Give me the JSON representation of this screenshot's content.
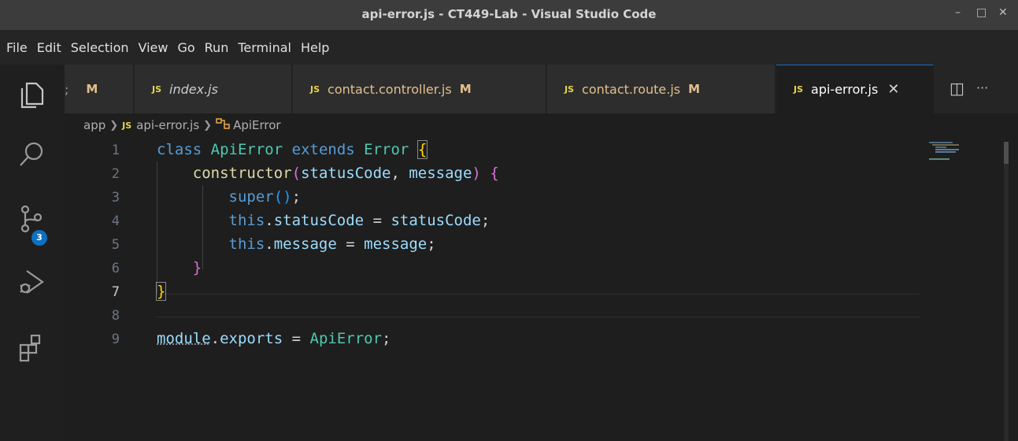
{
  "window": {
    "title": "api-error.js - CT449-Lab - Visual Studio Code",
    "minimize": "–",
    "maximize": "□",
    "close": "✕"
  },
  "menu": [
    "File",
    "Edit",
    "Selection",
    "View",
    "Go",
    "Run",
    "Terminal",
    "Help"
  ],
  "activity": {
    "icons": [
      "explorer-icon",
      "search-icon",
      "source-control-icon",
      "run-debug-icon",
      "extensions-icon"
    ],
    "source_control_badge": "3"
  },
  "tabs": [
    {
      "partial": ";",
      "mflag": "M"
    },
    {
      "lang": "JS",
      "name": "index.js"
    },
    {
      "lang": "JS",
      "name": "contact.controller.js",
      "mflag": "M"
    },
    {
      "lang": "JS",
      "name": "contact.route.js",
      "mflag": "M"
    },
    {
      "lang": "JS",
      "name": "api-error.js",
      "close": "✕"
    }
  ],
  "editor_actions": {
    "split": "◫",
    "more": "···"
  },
  "breadcrumb": {
    "folder": "app",
    "lang": "JS",
    "file": "api-error.js",
    "symbol": "ApiError"
  },
  "line_numbers": [
    "1",
    "2",
    "3",
    "4",
    "5",
    "6",
    "7",
    "8",
    "9"
  ],
  "code": {
    "l1": {
      "kw": "class",
      "cls": "ApiError",
      "kw2": "extends",
      "cls2": "Error",
      "brace": "{"
    },
    "l2": {
      "fn": "constructor",
      "p1": "(",
      "a": "statusCode",
      "comma": ", ",
      "b": "message",
      "p2": ")",
      "brace": "{"
    },
    "l3": {
      "kw": "super",
      "paren": "()",
      "semi": ";"
    },
    "l4": {
      "kw": "this",
      "dot": ".",
      "prop": "statusCode",
      "eq": " = ",
      "val": "statusCode",
      "semi": ";"
    },
    "l5": {
      "kw": "this",
      "dot": ".",
      "prop": "message",
      "eq": " = ",
      "val": "message",
      "semi": ";"
    },
    "l6": {
      "brace": "}"
    },
    "l7": {
      "brace": "}"
    },
    "l9": {
      "mod": "module",
      "dot": ".",
      "prop": "exports",
      "eq": " = ",
      "cls": "ApiError",
      "semi": ";"
    }
  },
  "colors": {
    "accent": "#0e70c0",
    "js_badge": "#e8d44d",
    "modified": "#e2c08d",
    "keyword": "#569cd6",
    "class": "#4ec9b0",
    "function": "#dcdcaa",
    "variable": "#9cdcfe",
    "bracket_gold": "#ffd700",
    "bracket_orchid": "#da70d6",
    "bracket_blue": "#179fff"
  }
}
